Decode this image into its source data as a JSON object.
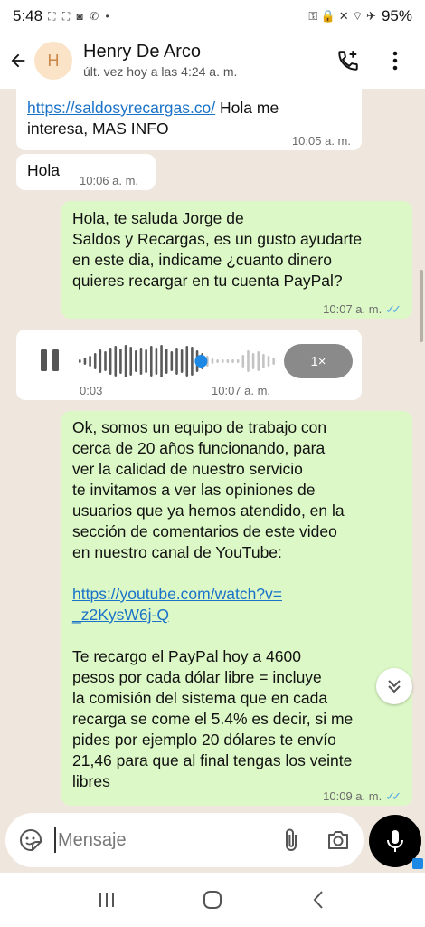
{
  "status_bar": {
    "time": "5:48",
    "left_icons": "⛶ ⛶ ◙ ✆ •",
    "right_icons": "⚿ 🔒 ✕ ⌔ ✈",
    "battery": "95%"
  },
  "header": {
    "avatar_letter": "H",
    "name": "Henry De Arco",
    "last_seen": "últ. vez hoy a las 4:24 a. m."
  },
  "messages": {
    "m1": {
      "link": "https://saldosyrecargas.co/",
      "text_after_link": " Hola me",
      "line2": "interesa, MAS INFO",
      "time": "10:05 a. m."
    },
    "m2": {
      "text": "Hola",
      "time": "10:06 a. m."
    },
    "m3": {
      "lines": [
        "Hola, te saluda Jorge de",
        "Saldos y Recargas, es un gusto ayudarte",
        "en este dia, indicame ¿cuanto dinero",
        "quieres recargar en tu cuenta PayPal?"
      ],
      "time": "10:07 a. m."
    },
    "voice": {
      "elapsed": "0:03",
      "time": "10:07 a. m.",
      "speed": "1×",
      "progress": 0.62
    },
    "m4": {
      "para1": [
        "Ok, somos un equipo de trabajo con",
        "cerca de 20 años funcionando, para",
        "ver la calidad de nuestro servicio",
        "te invitamos a ver las opiniones de",
        "usuarios que ya hemos atendido, en la",
        "sección de comentarios de este video",
        "en nuestro canal de YouTube:"
      ],
      "link_line1": "https://youtube.com/watch?v=",
      "link_line2": "_z2KysW6j-Q",
      "para2": [
        "Te recargo el PayPal hoy a 4600",
        "pesos por cada dólar libre = incluye",
        "la comisión del sistema que en cada",
        "recarga se come el 5.4% es decir, si me",
        "pides por ejemplo 20 dólares te envío",
        "21,46 para que al final tengas los veinte",
        "libres"
      ],
      "time": "10:09 a. m."
    }
  },
  "input": {
    "placeholder": "Mensaje"
  },
  "colors": {
    "chat_bg": "#efe7de",
    "outgoing_bubble": "#dcf8c6",
    "incoming_bubble": "#ffffff",
    "link": "#1a73c9",
    "read_ticks": "#4fa7e8"
  }
}
